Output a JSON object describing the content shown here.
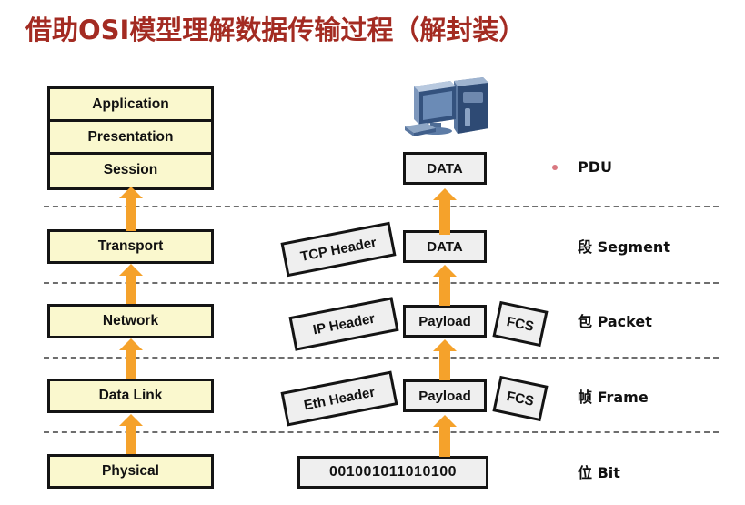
{
  "title": "借助OSI模型理解数据传输过程（解封装）",
  "colors": {
    "title": "#A32B22",
    "layer_fill": "#FAF8CE",
    "unit_fill": "#EFEFEF",
    "arrow": "#F5A22B",
    "border": "#141414",
    "divider": "#6E6E6E"
  },
  "osi_stack": {
    "upper_group": [
      {
        "label": "Application"
      },
      {
        "label": "Presentation"
      },
      {
        "label": "Session"
      }
    ],
    "layers": [
      {
        "label": "Transport"
      },
      {
        "label": "Network"
      },
      {
        "label": "Data Link"
      },
      {
        "label": "Physical"
      }
    ]
  },
  "data_units": {
    "pdu_row": {
      "data": "DATA"
    },
    "segment_row": {
      "header": "TCP Header",
      "data": "DATA"
    },
    "packet_row": {
      "header": "IP Header",
      "data": "Payload",
      "trailer": "FCS"
    },
    "frame_row": {
      "header": "Eth Header",
      "data": "Payload",
      "trailer": "FCS"
    },
    "bit_row": {
      "bits": "001001011010100"
    }
  },
  "right_labels": [
    {
      "text": "PDU"
    },
    {
      "text": "段 Segment"
    },
    {
      "text": "包 Packet"
    },
    {
      "text": "帧 Frame"
    },
    {
      "text": "位 Bit"
    }
  ],
  "icons": {
    "computer": "desktop-computer-icon"
  }
}
